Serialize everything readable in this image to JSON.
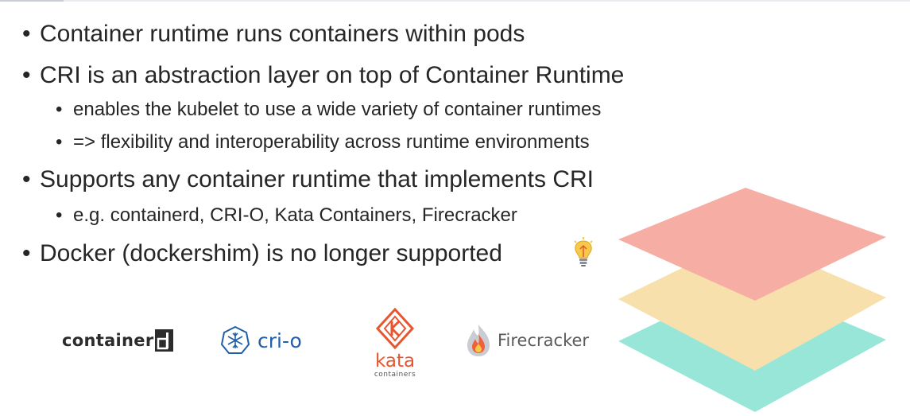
{
  "bullets": [
    {
      "level": 1,
      "text": "Container runtime runs containers within pods"
    },
    {
      "level": 1,
      "text": "CRI is an abstraction layer on top of Container Runtime"
    },
    {
      "level": 2,
      "text": "enables the kubelet to use a wide variety of container runtimes"
    },
    {
      "level": 2,
      "text": "=> flexibility and interoperability across runtime environments"
    },
    {
      "level": 1,
      "text": "Supports any container runtime that implements CRI"
    },
    {
      "level": 2,
      "text": "e.g. containerd, CRI-O, Kata Containers, Firecracker"
    },
    {
      "level": 1,
      "text": "Docker (dockershim) is no longer supported"
    }
  ],
  "bullet_symbol": "•",
  "logos": {
    "containerd": {
      "word": "container",
      "box_letter": "d"
    },
    "crio": {
      "word": "cri-o"
    },
    "kata": {
      "word": "kata",
      "sub": "containers"
    },
    "firecracker": {
      "word": "Firecracker"
    }
  },
  "colors": {
    "text": "#262626",
    "layer_top": "#f6aea4",
    "layer_middle": "#f8e0ad",
    "layer_bottom": "#97e6d8",
    "crio_blue": "#1f5fa8",
    "kata_orange": "#e6562f",
    "bulb_yellow": "#f7c948"
  },
  "icons": [
    "lightbulb-icon",
    "stacked-layers-illustration"
  ]
}
